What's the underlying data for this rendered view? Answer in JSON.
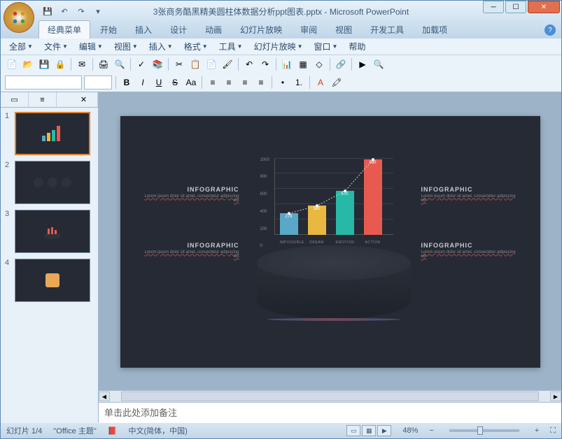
{
  "title": "3张商务酷黑精美圆柱体数据分析ppt图表.pptx - Microsoft PowerPoint",
  "ribbon_tabs": [
    "经典菜单",
    "开始",
    "插入",
    "设计",
    "动画",
    "幻灯片放映",
    "审阅",
    "视图",
    "开发工具",
    "加载项"
  ],
  "active_ribbon_tab": 0,
  "classic_menu": [
    "全部",
    "文件",
    "编辑",
    "视图",
    "插入",
    "格式",
    "工具",
    "幻灯片放映",
    "窗口",
    "帮助"
  ],
  "font_name": "",
  "font_size": "",
  "thumbs": [
    1,
    2,
    3,
    4
  ],
  "active_thumb": 1,
  "info": {
    "title": "INFOGRAPHIC",
    "sub": "Lorem ipsum dolor sit amet, consectetur adipiscing elit"
  },
  "chart_data": {
    "type": "bar",
    "categories": [
      "IMPOSSIBLE",
      "DREAM",
      "EMOTION",
      "ACTION"
    ],
    "values": [
      279,
      380,
      570,
      980
    ],
    "colors": [
      "#5aa8c8",
      "#e8b840",
      "#28b8a8",
      "#e85a50"
    ],
    "ylim": [
      0,
      1000
    ],
    "yticks": [
      0,
      200,
      400,
      600,
      800,
      1000
    ],
    "title": "",
    "xlabel": "",
    "ylabel": ""
  },
  "notes_placeholder": "单击此处添加备注",
  "status": {
    "slide": "幻灯片 1/4",
    "theme": "\"Office 主题\"",
    "lang": "中文(简体，中国)",
    "zoom": "48%"
  }
}
